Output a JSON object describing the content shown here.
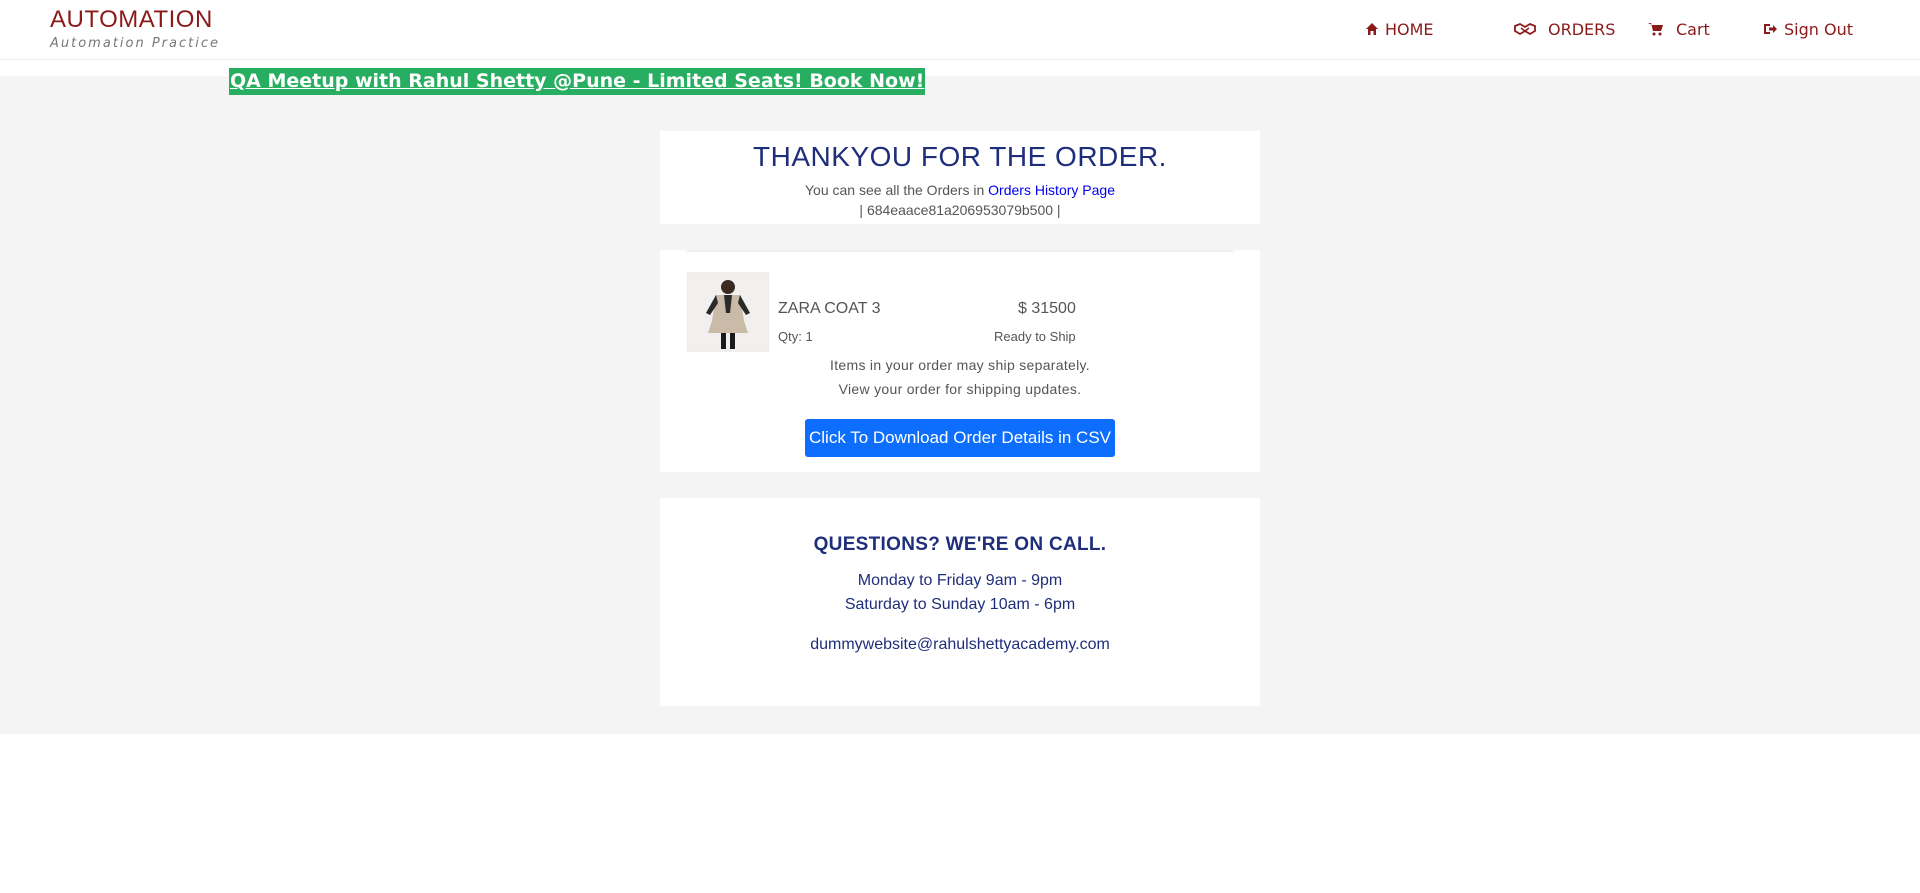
{
  "header": {
    "logo_title": "AUTOMATION",
    "logo_subtitle": "Automation Practice",
    "nav": {
      "home": "HOME",
      "orders": "ORDERS",
      "cart": "Cart",
      "sign_out": "Sign Out"
    },
    "nav_icons": [
      "home-icon",
      "handshake-icon",
      "cart-icon",
      "sign-out-icon"
    ]
  },
  "promo": {
    "text": "QA Meetup with Rahul Shetty @Pune - Limited Seats! Book Now!"
  },
  "thanks": {
    "title": "THANKYOU FOR THE ORDER.",
    "text": "You can see all the Orders in ",
    "link": "Orders History Page",
    "order_id": "| 684eaace81a206953079b500 |"
  },
  "order": {
    "product_name": "ZARA COAT 3",
    "price": "$ 31500",
    "qty": "Qty: 1",
    "status": "Ready to Ship",
    "ship_note_1": "Items in your order may ship separately.",
    "ship_note_2": "View your order for shipping updates.",
    "csv_button": "Click To Download Order Details in CSV"
  },
  "questions": {
    "title": "QUESTIONS? WE'RE ON CALL.",
    "hours_weekday": "Monday to Friday 9am - 9pm",
    "hours_weekend": "Saturday to Sunday 10am - 6pm",
    "email": "dummywebsite@rahulshettyacademy.com"
  },
  "colors": {
    "brand": "#8b1a1a",
    "promo_bg": "#27ae60",
    "heading": "#1f2e7a",
    "button": "#0d6efd",
    "page_bg": "#f4f4f4"
  }
}
